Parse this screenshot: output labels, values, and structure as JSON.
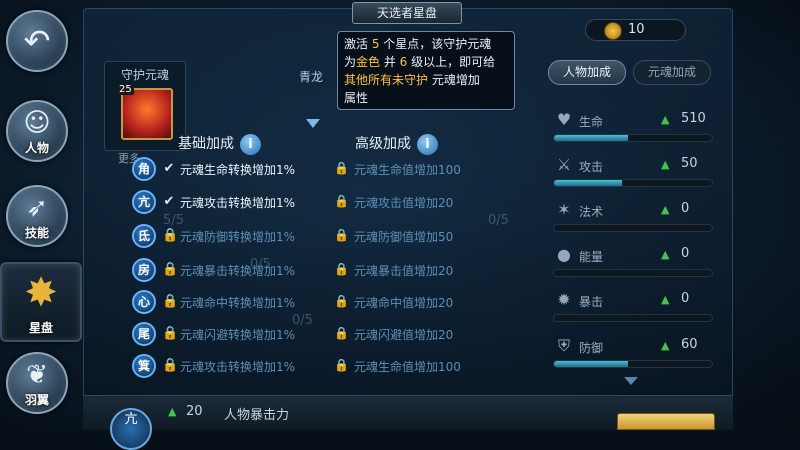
{
  "nav": {
    "items": [
      {
        "label": "",
        "icon": "back-arrow-icon"
      },
      {
        "label": "人物",
        "icon": "character-icon"
      },
      {
        "label": "技能",
        "icon": "skill-icon"
      },
      {
        "label": "星盘",
        "icon": "star-icon"
      },
      {
        "label": "羽翼",
        "icon": "wings-icon"
      }
    ]
  },
  "header": {
    "title": "天选者星盘"
  },
  "currency": {
    "value": "10",
    "icon": "coin-icon"
  },
  "guardian": {
    "title": "守护元魂",
    "level": "25",
    "more_label": "更多",
    "dragon_name": "青龙"
  },
  "tooltip": {
    "line1_pre": "激活 ",
    "line1_num": "5",
    "line1_post": " 个星点，该守护元魂",
    "line2_pre": "为",
    "line2_gold": "金色",
    "line2_mid": " 并 ",
    "line2_num": "6",
    "line2_post": " 级以上，即可给",
    "line3_pre": "其他所有未守护 ",
    "line3_post": "元魂增加",
    "line4": "属性"
  },
  "bonus": {
    "basic_header": "基础加成",
    "advanced_header": "高级加成",
    "info_glyph": "i",
    "rows": [
      {
        "star": "角",
        "basic_done": true,
        "basic": "元魂生命转换增加1%",
        "advanced": "元魂生命值增加100"
      },
      {
        "star": "亢",
        "basic_done": true,
        "basic": "元魂攻击转换增加1%",
        "advanced": "元魂攻击值增加20"
      },
      {
        "star": "氐",
        "basic_done": false,
        "basic": "元魂防御转换增加1%",
        "advanced": "元魂防御值增加50"
      },
      {
        "star": "房",
        "basic_done": false,
        "basic": "元魂暴击转换增加1%",
        "advanced": "元魂暴击值增加20"
      },
      {
        "star": "心",
        "basic_done": false,
        "basic": "元魂命中转换增加1%",
        "advanced": "元魂命中值增加20"
      },
      {
        "star": "尾",
        "basic_done": false,
        "basic": "元魂闪避转换增加1%",
        "advanced": "元魂闪避值增加20"
      },
      {
        "star": "箕",
        "basic_done": false,
        "basic": "元魂攻击转换增加1%",
        "advanced": "元魂生命值增加100"
      }
    ],
    "check_glyph": "✔",
    "lock_glyph": "🔒"
  },
  "ghost_labels": [
    "5/5",
    "0/5",
    "0/5",
    "0/5"
  ],
  "tabs": {
    "active": "人物加成",
    "inactive": "元魂加成"
  },
  "stats": [
    {
      "label": "生命",
      "value": "510",
      "fill": 0.47,
      "icon": "heart-icon"
    },
    {
      "label": "攻击",
      "value": "50",
      "fill": 0.43,
      "icon": "sword-icon"
    },
    {
      "label": "法术",
      "value": "0",
      "fill": 0,
      "icon": "magic-icon"
    },
    {
      "label": "能量",
      "value": "0",
      "fill": 0,
      "icon": "drop-icon"
    },
    {
      "label": "暴击",
      "value": "0",
      "fill": 0,
      "icon": "crit-icon"
    },
    {
      "label": "防御",
      "value": "60",
      "fill": 0.47,
      "icon": "shield-icon"
    }
  ],
  "bottom": {
    "badge": "亢",
    "value": "20",
    "label": "人物暴击力"
  },
  "watermark": "",
  "colors": {
    "accent": "#ffc23a",
    "stat_up": "#43c44c",
    "star_badge": "#2f7ccc"
  }
}
